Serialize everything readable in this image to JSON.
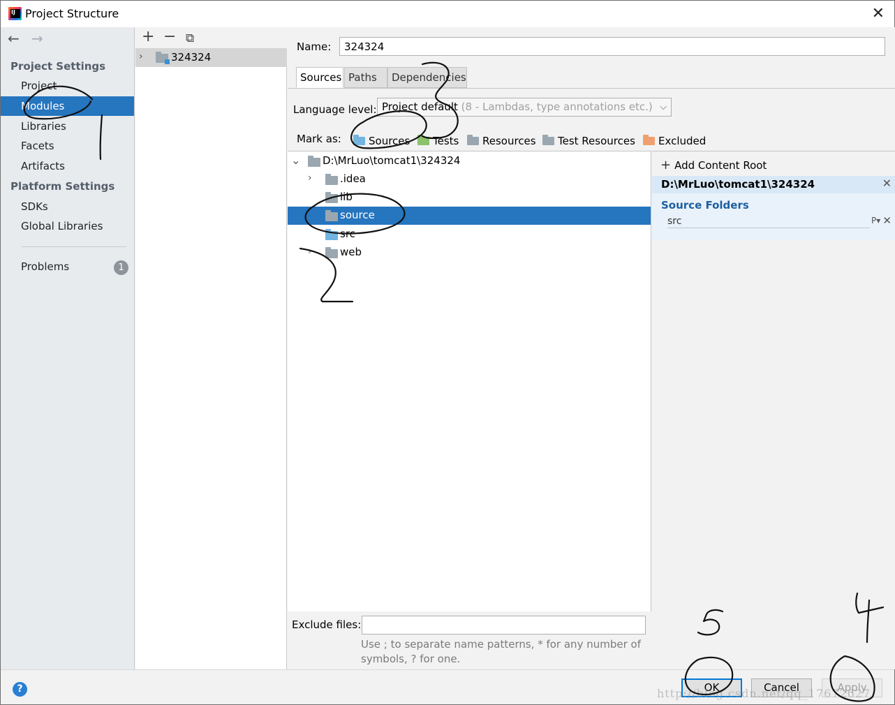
{
  "window": {
    "title": "Project Structure"
  },
  "sidebar": {
    "project_settings_header": "Project Settings",
    "platform_settings_header": "Platform Settings",
    "items": [
      {
        "label": "Project"
      },
      {
        "label": "Modules"
      },
      {
        "label": "Libraries"
      },
      {
        "label": "Facets"
      },
      {
        "label": "Artifacts"
      },
      {
        "label": "SDKs"
      },
      {
        "label": "Global Libraries"
      },
      {
        "label": "Problems"
      }
    ],
    "problems_count": "1"
  },
  "modules": {
    "add_icon": "plus-icon",
    "remove_icon": "minus-icon",
    "copy_icon": "copy-icon",
    "items": [
      {
        "name": "324324"
      }
    ]
  },
  "main": {
    "name_label": "Name:",
    "name_value": "324324",
    "tabs": [
      {
        "label": "Sources"
      },
      {
        "label": "Paths"
      },
      {
        "label": "Dependencies"
      }
    ],
    "language_level_label": "Language level:",
    "language_level_value": "Project default",
    "language_level_suffix": "(8 - Lambdas, type annotations etc.)",
    "mark_as_label": "Mark as:",
    "mark_as": [
      {
        "label": "Sources",
        "color": "#73b4e0"
      },
      {
        "label": "Tests",
        "color": "#8cc26b"
      },
      {
        "label": "Resources",
        "color": "#9aa7b0"
      },
      {
        "label": "Test Resources",
        "color": "#9aa7b0"
      },
      {
        "label": "Excluded",
        "color": "#f0a070"
      }
    ],
    "tree": {
      "root": "D:\\MrLuo\\tomcat1\\324324",
      "children": [
        {
          "label": ".idea"
        },
        {
          "label": "lib"
        },
        {
          "label": "source"
        },
        {
          "label": "src"
        },
        {
          "label": "web"
        }
      ]
    },
    "exclude_label": "Exclude files:",
    "exclude_value": "",
    "exclude_hint": "Use ; to separate name patterns, * for any number of symbols, ? for one."
  },
  "roots": {
    "add_label": "Add Content Root",
    "path": "D:\\MrLuo\\tomcat1\\324324",
    "source_folders_header": "Source Folders",
    "source_folders": [
      {
        "label": "src"
      }
    ],
    "properties_label": "P"
  },
  "buttons": {
    "ok": "OK",
    "cancel": "Cancel",
    "apply": "Apply",
    "help": "?"
  },
  "watermark": "http://blog.csdn.net/qq_17672627",
  "colors": {
    "selection": "#2675bf",
    "accent": "#0078d7"
  }
}
